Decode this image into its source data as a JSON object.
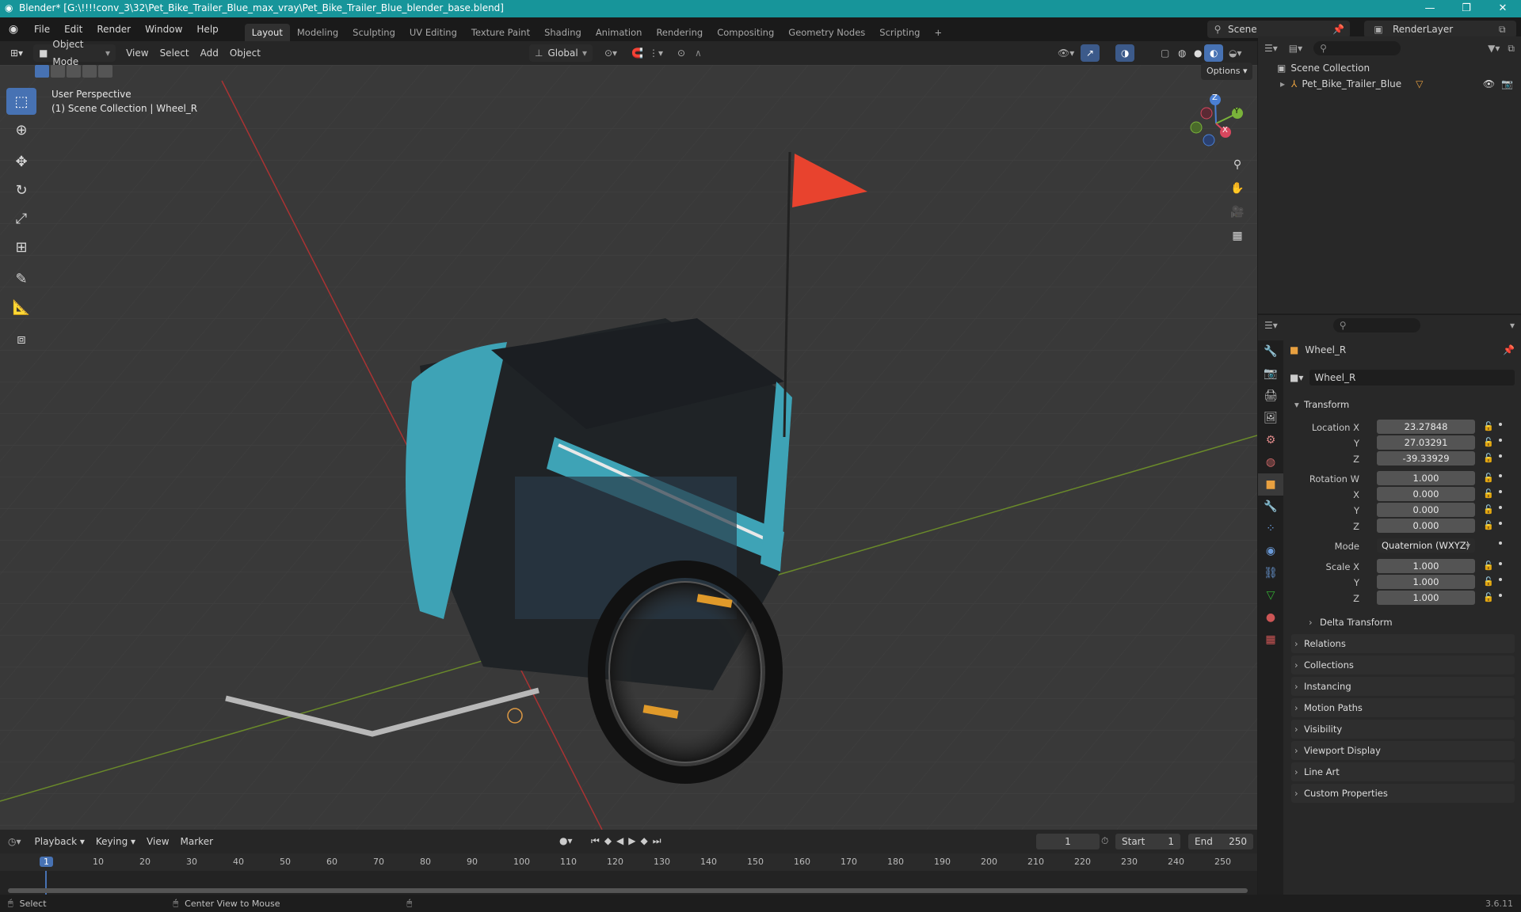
{
  "title_bar": {
    "title": "Blender* [G:\\!!!!conv_3\\32\\Pet_Bike_Trailer_Blue_max_vray\\Pet_Bike_Trailer_Blue_blender_base.blend]",
    "minimize": "—",
    "maximize": "❐",
    "close": "✕"
  },
  "menu": {
    "items": [
      "File",
      "Edit",
      "Render",
      "Window",
      "Help"
    ],
    "workspaces": [
      "Layout",
      "Modeling",
      "Sculpting",
      "UV Editing",
      "Texture Paint",
      "Shading",
      "Animation",
      "Rendering",
      "Compositing",
      "Geometry Nodes",
      "Scripting"
    ],
    "add_workspace": "+",
    "scene": "Scene",
    "render_layer": "RenderLayer"
  },
  "viewport_header": {
    "mode": "Object Mode",
    "menus": [
      "View",
      "Select",
      "Add",
      "Object"
    ],
    "orientation": "Global",
    "options": "Options"
  },
  "viewport": {
    "perspective": "User Perspective",
    "collection_line": "(1) Scene Collection | Wheel_R"
  },
  "gizmo": {
    "z": "Z",
    "y": "Y",
    "x": "X"
  },
  "outliner": {
    "root": "Scene Collection",
    "object": "Pet_Bike_Trailer_Blue"
  },
  "properties": {
    "object_name": "Wheel_R",
    "data_name": "Wheel_R",
    "transform_title": "Transform",
    "location": {
      "label": "Location X",
      "x": "23.27848",
      "y": "27.03291",
      "z": "-39.33929"
    },
    "rotation": {
      "label": "Rotation W",
      "w": "1.000",
      "x": "0.000",
      "y": "0.000",
      "z": "0.000"
    },
    "mode_label": "Mode",
    "mode_value": "Quaternion (WXYZ)",
    "scale": {
      "label": "Scale X",
      "x": "1.000",
      "y": "1.000",
      "z": "1.000"
    },
    "axis_y": "Y",
    "axis_z": "Z",
    "axis_x": "X",
    "delta": "Delta Transform",
    "sections": [
      "Relations",
      "Collections",
      "Instancing",
      "Motion Paths",
      "Visibility",
      "Viewport Display",
      "Line Art",
      "Custom Properties"
    ]
  },
  "timeline": {
    "menus": [
      "Playback",
      "Keying",
      "View",
      "Marker"
    ],
    "current_frame": "1",
    "start_label": "Start",
    "start": "1",
    "end_label": "End",
    "end": "250",
    "ticks": [
      "1",
      "10",
      "20",
      "30",
      "40",
      "50",
      "60",
      "70",
      "80",
      "90",
      "100",
      "110",
      "120",
      "130",
      "140",
      "150",
      "160",
      "170",
      "180",
      "190",
      "200",
      "210",
      "220",
      "230",
      "240",
      "250"
    ]
  },
  "status": {
    "select": "Select",
    "center": "Center View to Mouse",
    "version": "3.6.11"
  }
}
